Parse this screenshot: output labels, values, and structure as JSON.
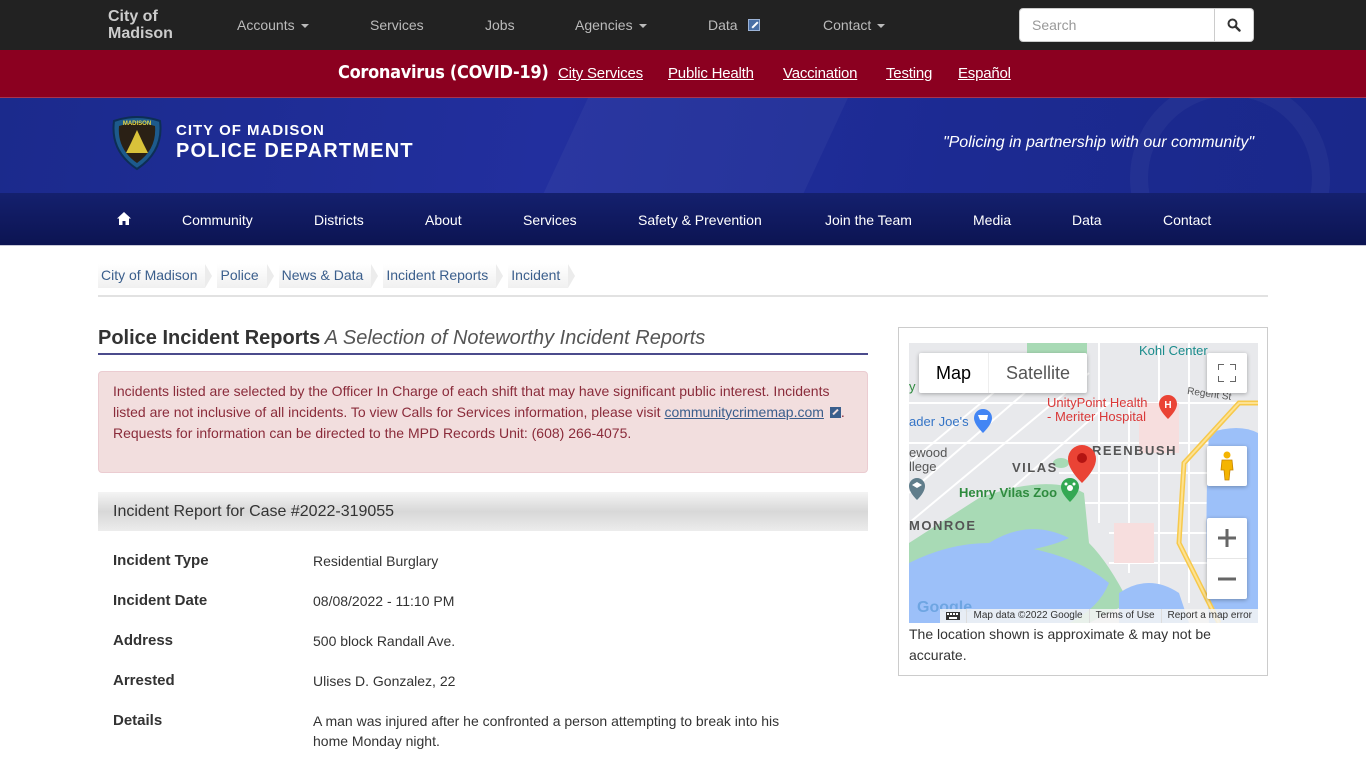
{
  "topbar": {
    "brand_line1": "City of",
    "brand_line2": "Madison",
    "nav": [
      {
        "label": "Accounts",
        "dropdown": true
      },
      {
        "label": "Services",
        "dropdown": false
      },
      {
        "label": "Jobs",
        "dropdown": false
      },
      {
        "label": "Agencies",
        "dropdown": true
      },
      {
        "label": "Data",
        "dropdown": false,
        "icon": "external-data-icon"
      },
      {
        "label": "Contact",
        "dropdown": true
      }
    ],
    "search_placeholder": "Search",
    "search_value": "",
    "search_icon": "search-icon"
  },
  "covid": {
    "title": "Coronavirus (COVID-19)",
    "links": [
      "City Services",
      "Public Health",
      "Vaccination",
      "Testing",
      "Español"
    ],
    "color": "#8b0020"
  },
  "header": {
    "badge_icon": "madison-police-badge-icon",
    "line1": "CITY OF MADISON",
    "line2": "POLICE DEPARTMENT",
    "motto": "\"Policing in partnership with our community\""
  },
  "mainnav": {
    "home_icon": "home-icon",
    "items": [
      "Community",
      "Districts",
      "About",
      "Services",
      "Safety & Prevention",
      "Join the Team",
      "Media",
      "Data",
      "Contact"
    ]
  },
  "breadcrumb": [
    "City of Madison",
    "Police",
    "News & Data",
    "Incident Reports",
    "Incident"
  ],
  "page": {
    "title": "Police Incident Reports",
    "subtitle": "A Selection of Noteworthy Incident Reports"
  },
  "alert": {
    "text1": "Incidents listed are selected by the Officer In Charge of each shift that may have significant public interest. Incidents listed are not inclusive of all incidents. To view Calls for Services information, please visit ",
    "link": "communitycrimemap.com",
    "text2": ". Requests for information can be directed to the MPD Records Unit: (608) 266-4075."
  },
  "incident": {
    "heading": "Incident Report for Case #2022-319055",
    "fields": [
      {
        "label": "Incident Type",
        "value": "Residential Burglary"
      },
      {
        "label": "Incident Date",
        "value": "08/08/2022 - 11:10 PM"
      },
      {
        "label": "Address",
        "value": "500 block Randall Ave."
      },
      {
        "label": "Arrested",
        "value": "Ulises D. Gonzalez, 22"
      },
      {
        "label": "Details",
        "value": "A man was injured after he confronted a person attempting to break into his home Monday night."
      }
    ]
  },
  "map": {
    "type_buttons": [
      "Map",
      "Satellite"
    ],
    "selected_type": "Map",
    "labels": {
      "kohl": "Kohl Center",
      "hospital1": "UnityPoint Health",
      "hospital2": "- Meriter Hospital",
      "traderjoes": "ader Joe's",
      "edgewood1": "ewood",
      "edgewood2": "llege",
      "vilas": "VILAS",
      "greenbush": "REENBUSH",
      "zoo": "Henry Vilas Zoo",
      "monroe": "MONROE",
      "regent": "Regent St",
      "y": "y"
    },
    "attribution": [
      "Map data ©2022 Google",
      "Terms of Use",
      "Report a map error"
    ],
    "caption": "The location shown is approximate & may not be accurate."
  }
}
